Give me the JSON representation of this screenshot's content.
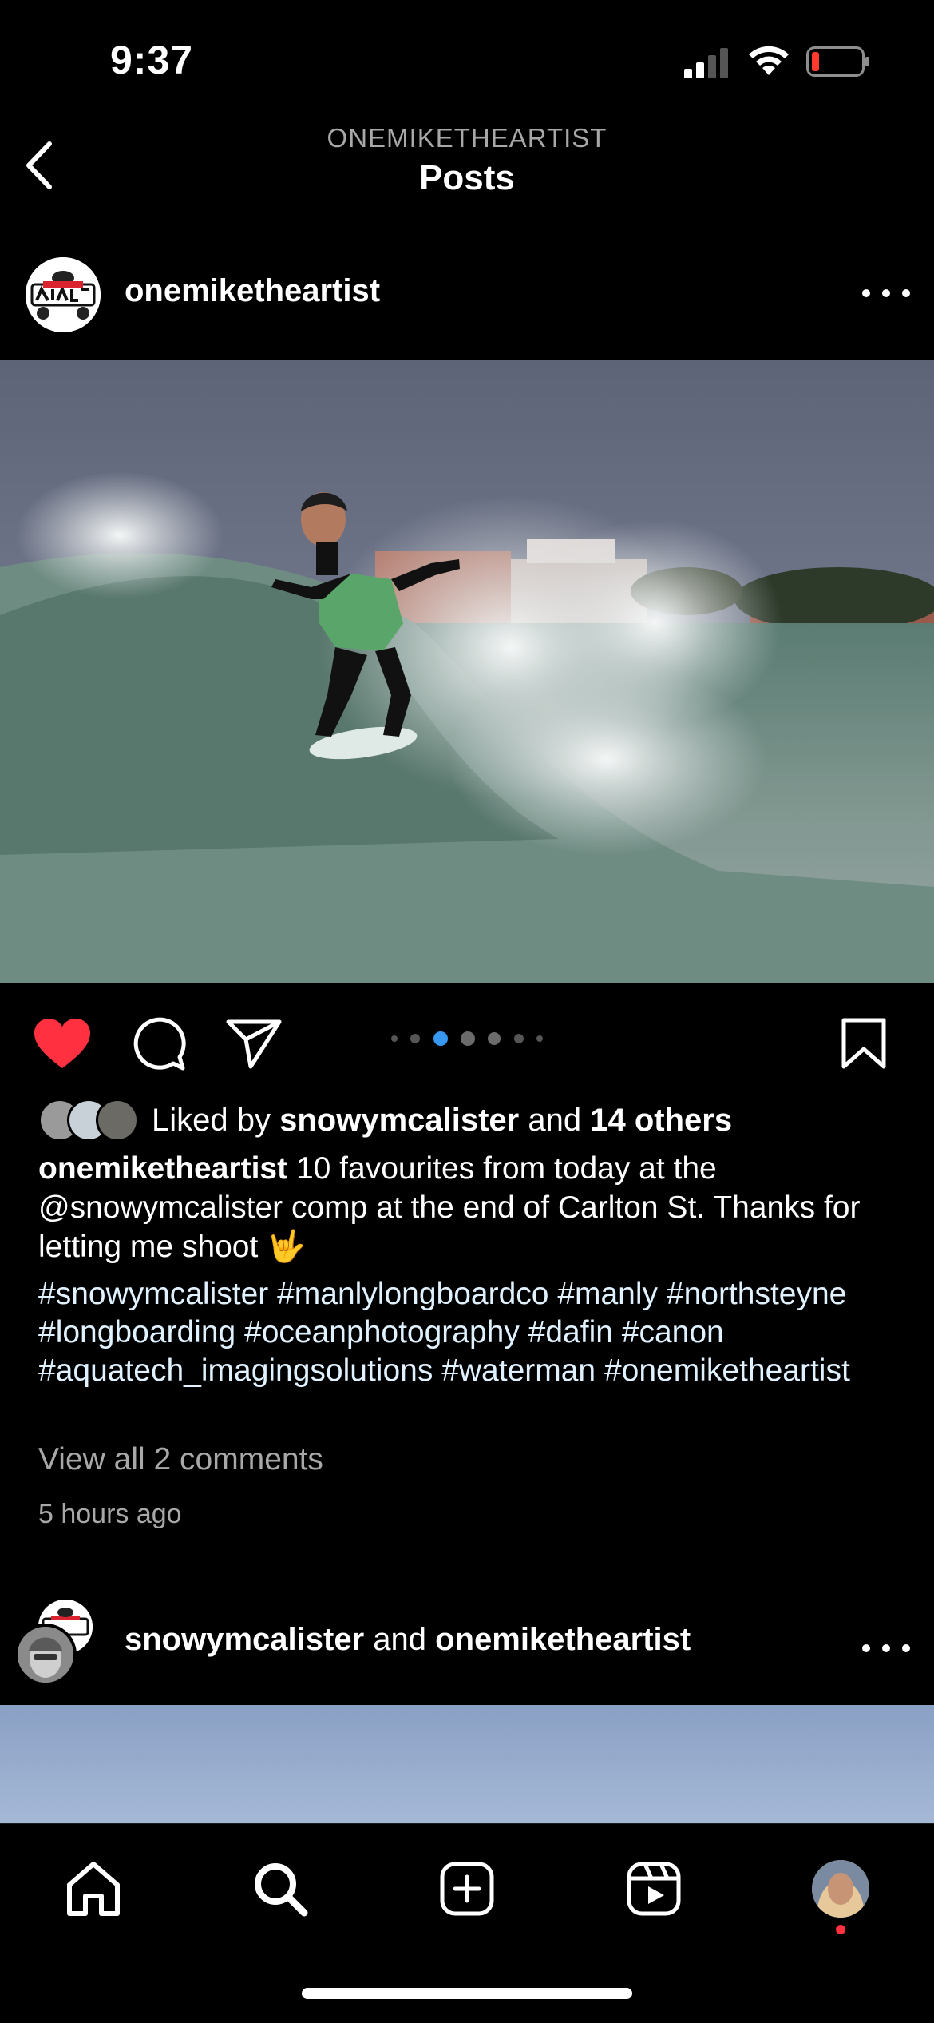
{
  "status_bar": {
    "time": "9:37"
  },
  "header": {
    "subtitle": "ONEMIKETHEARTIST",
    "title": "Posts"
  },
  "post": {
    "username": "onemiketheartist",
    "carousel": {
      "count": 6,
      "active_index": 1
    },
    "liked_by_prefix": "Liked by",
    "liked_by_user": "snowymcalister",
    "liked_by_and": "and",
    "liked_by_others": "14 others",
    "caption_user": "onemiketheartist",
    "caption_text": "10 favourites from today at the @snowymcalister comp at the end of Carlton St. Thanks for letting me shoot 🤟",
    "hashtags": "#snowymcalister #manlylongboardco #manly #northsteyne #longboarding #oceanphotography #dafin #canon #aquatech_imagingsolutions #waterman #onemiketheartist",
    "view_comments": "View all 2 comments",
    "time_ago": "5 hours ago"
  },
  "post2": {
    "user1": "snowymcalister",
    "joiner": "and",
    "user2": "onemiketheartist"
  },
  "colors": {
    "like_red": "#ff3040",
    "active_dot": "#3897f0",
    "background": "#000000"
  },
  "tab_bar": {
    "items": [
      "home-icon",
      "search-icon",
      "create-icon",
      "reels-icon",
      "profile-avatar"
    ]
  }
}
